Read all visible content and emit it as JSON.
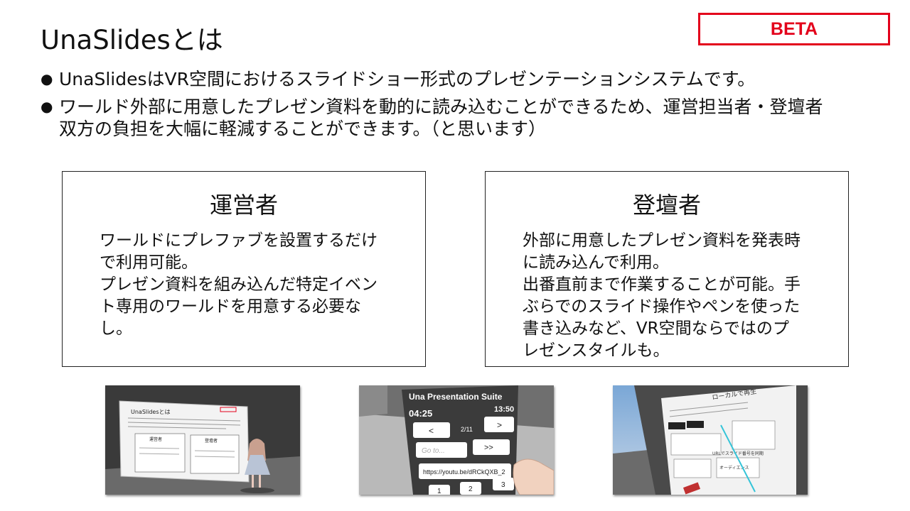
{
  "title": "UnaSlidesとは",
  "badge": "BETA",
  "bullets": [
    "UnaSlidesはVR空間におけるスライドショー形式のプレゼンテーションシステムです。",
    "ワールド外部に用意したプレゼン資料を動的に読み込むことができるため、運営担当者・登壇者\n双方の負担を大幅に軽減することができます。（と思います）"
  ],
  "cards": [
    {
      "heading": "運営者",
      "body": "ワールドにプレファブを設置するだけ\nで利用可能。\nプレゼン資料を組み込んだ特定イベン\nト専用のワールドを用意する必要な\nし。"
    },
    {
      "heading": "登壇者",
      "body": "外部に用意したプレゼン資料を発表時\nに読み込んで利用。\n出番直前まで作業することが可能。手\nぶらでのスライド操作やペンを使った\n書き込みなど、VR空間ならではのプ\nレゼンスタイルも。"
    }
  ],
  "screenshots": {
    "one": {
      "slide_title": "UnaSlidesとは",
      "box_left": "運営者",
      "box_right": "登壇者"
    },
    "two": {
      "app_title": "Una Presentation Suite",
      "elapsed": "04:25",
      "clock": "13:50",
      "prev": "<",
      "next": ">",
      "page": "2/11",
      "goto_placeholder": "Go to...",
      "goto_button": ">>",
      "url": "https://youtu.be/dRCkQXB_2",
      "key1": "1",
      "key2": "2",
      "key3": "3"
    },
    "three": {
      "header": "ローカルで再生",
      "label_a": "URLでスライド番号を同期",
      "label_b": "オーディエンス"
    }
  },
  "colors": {
    "accent_red": "#e3001b"
  }
}
